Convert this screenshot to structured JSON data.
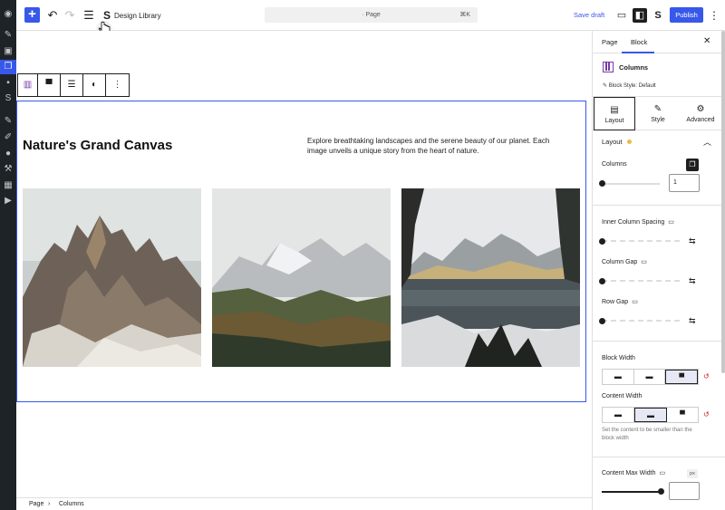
{
  "admin_menu": {
    "icons": [
      "dashboard-icon",
      "pin-icon",
      "media-icon",
      "pages-icon",
      "comments-icon",
      "stackable-icon",
      "appearance-icon",
      "plugins-icon",
      "users-icon",
      "tools-icon",
      "settings-icon",
      "play-icon"
    ]
  },
  "toolbar": {
    "design_library_label": "Design Library",
    "command_label": "· Page",
    "command_shortcut": "⌘K",
    "save_draft_label": "Save draft",
    "publish_label": "Publish"
  },
  "canvas": {
    "heading": "Nature's Grand Canvas",
    "description": "Explore breathtaking landscapes and the serene beauty of our planet. Each image unveils a unique story from the heart of nature."
  },
  "breadcrumb": {
    "items": [
      "Page",
      "Columns"
    ]
  },
  "sidebar": {
    "tabs": [
      "Page",
      "Block"
    ],
    "active_tab": "Block",
    "block_title": "Columns",
    "block_style": "Block Style: Default",
    "inspector_tabs": [
      "Layout",
      "Style",
      "Advanced"
    ],
    "panel_title": "Layout",
    "columns_label": "Columns",
    "columns_value": "1",
    "columns_slider_level": 0,
    "inner_spacing_label": "Inner Column Spacing",
    "column_gap_label": "Column Gap",
    "row_gap_label": "Row Gap",
    "block_width_label": "Block Width",
    "content_width_label": "Content Width",
    "content_width_help": "Set the content to be smaller than the block width",
    "content_max_width_label": "Content Max Width",
    "content_max_width_unit": "px",
    "content_max_width_slider_level": 1.0
  },
  "colors": {
    "accent": "#3858e9",
    "admin_bg": "#1d2327",
    "columns_icon": "#7a3aa6",
    "changed_dot": "#f0b849",
    "reset": "#cc1818"
  }
}
